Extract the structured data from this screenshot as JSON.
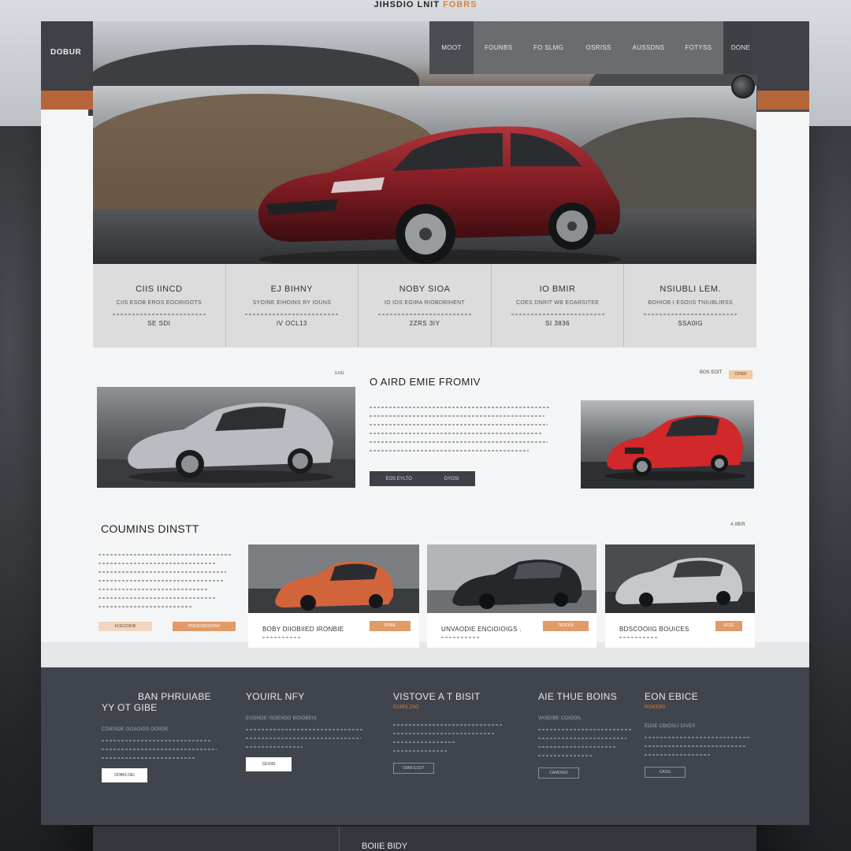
{
  "top_caption": {
    "main": "JIHSDIO LNIT",
    "accent": "FOBRS"
  },
  "header": {
    "logo": "DOBUR",
    "nav": [
      {
        "label": "MOOT"
      },
      {
        "label": "FOUNBS"
      },
      {
        "label": "FO SLMG"
      },
      {
        "label": "OSRISS"
      },
      {
        "label": "AUSSDNS"
      },
      {
        "label": "FOTYSS"
      },
      {
        "label": "DONE"
      }
    ]
  },
  "stats": [
    {
      "title": "CIIS IINCD",
      "sub": "CIIS ESOB EROS EOORIGOTS",
      "value": "SE SDI"
    },
    {
      "title": "EJ BIHNY",
      "sub": "SYOINE EIHOINS RY IOUNS",
      "value": "IV OCL13"
    },
    {
      "title": "NOBY SIOA",
      "sub": "IO IOS EGIRA RIOBDRIHENT",
      "value": "2ZRS 3IY"
    },
    {
      "title": "IO BMIR",
      "sub": "COES DNRIT WB EOARSITEE",
      "value": "SI 3836"
    },
    {
      "title": "NSIUBLI LEM.",
      "sub": "BOHIOB I ESOIIS TNIUBLIRSS",
      "value": "SSA0IG"
    }
  ],
  "feature": {
    "small_label": "ILNG",
    "title": "O AIRD EMIE FROMIV",
    "right_label": "BOS EOIT",
    "right_tag": "CPIER",
    "button_left": "EOS EYLTO",
    "button_right": "DYOSI"
  },
  "gallery": {
    "title": "COUMINS DINSTT",
    "link": "A IIBIR",
    "btn_a": "EOESOIOB",
    "btn_b": "POESOIIIRSIONY",
    "cards": [
      {
        "label": "BOBY DIIOBIIED IRONBIE",
        "tag": "DOBE"
      },
      {
        "label": "UNVAODIE ENCIOIOIGS .",
        "tag": "TEOOLB"
      },
      {
        "label": "BDSCOOIIG BOUICES",
        "tag": "ECIG"
      }
    ]
  },
  "footer": {
    "columns": [
      {
        "over": "BAN PHRUIABE",
        "heading": "YY OT GIBE",
        "sub": "COIESOE OOAOIGS OOIIOE",
        "button": "DOIBS OEI"
      },
      {
        "heading": "YOUIRL NFY",
        "sub": "EUONOE ISOEIIOO BOIOBEIS",
        "button": "CEOIIS"
      },
      {
        "heading": "VISTOVE A T BISIT",
        "accent": "EOIRS ZSO",
        "sub": "",
        "button": "OIAN ESOT"
      },
      {
        "heading": "AIE THUE BOINS",
        "sub": "VASDIBE COIGOIL",
        "button": "CAMOIEO"
      },
      {
        "heading": "EON EBICE",
        "accent": "ROIEEBS",
        "sub": "EDIIE CBIOSLI DIVES",
        "button": "CAOG"
      }
    ]
  },
  "bottom_bar": {
    "text": "BOIIE BIDY"
  },
  "colors": {
    "accent": "#d9823b",
    "dark": "#40444c",
    "nav": "#6a6c70",
    "hero_car": "#8b1f24"
  }
}
